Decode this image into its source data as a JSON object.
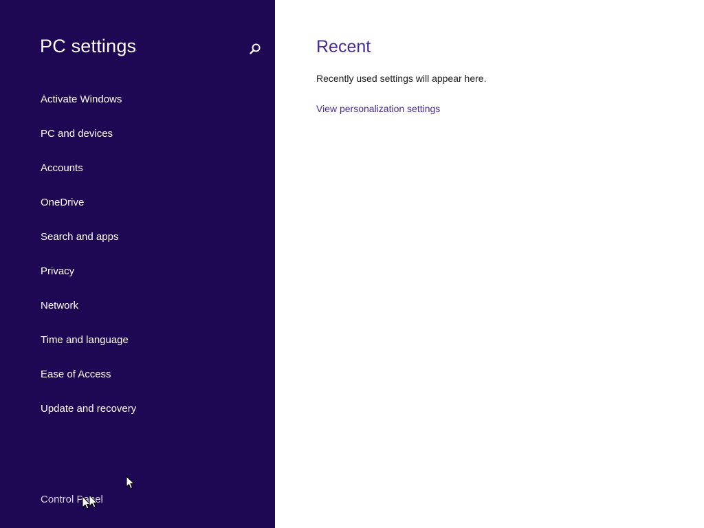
{
  "app": {
    "title": "PC settings"
  },
  "sidebar": {
    "background": "#1e0753",
    "search_icon": "magnifier-icon",
    "items": [
      {
        "label": "Activate Windows"
      },
      {
        "label": "PC and devices"
      },
      {
        "label": "Accounts"
      },
      {
        "label": "OneDrive"
      },
      {
        "label": "Search and apps"
      },
      {
        "label": "Privacy"
      },
      {
        "label": "Network"
      },
      {
        "label": "Time and language"
      },
      {
        "label": "Ease of Access"
      },
      {
        "label": "Update and recovery"
      }
    ],
    "control_panel_label": "Control Panel"
  },
  "main": {
    "title": "Recent",
    "empty_message": "Recently used settings will appear here.",
    "link_label": "View personalization settings",
    "accent": "#4b2a91"
  }
}
